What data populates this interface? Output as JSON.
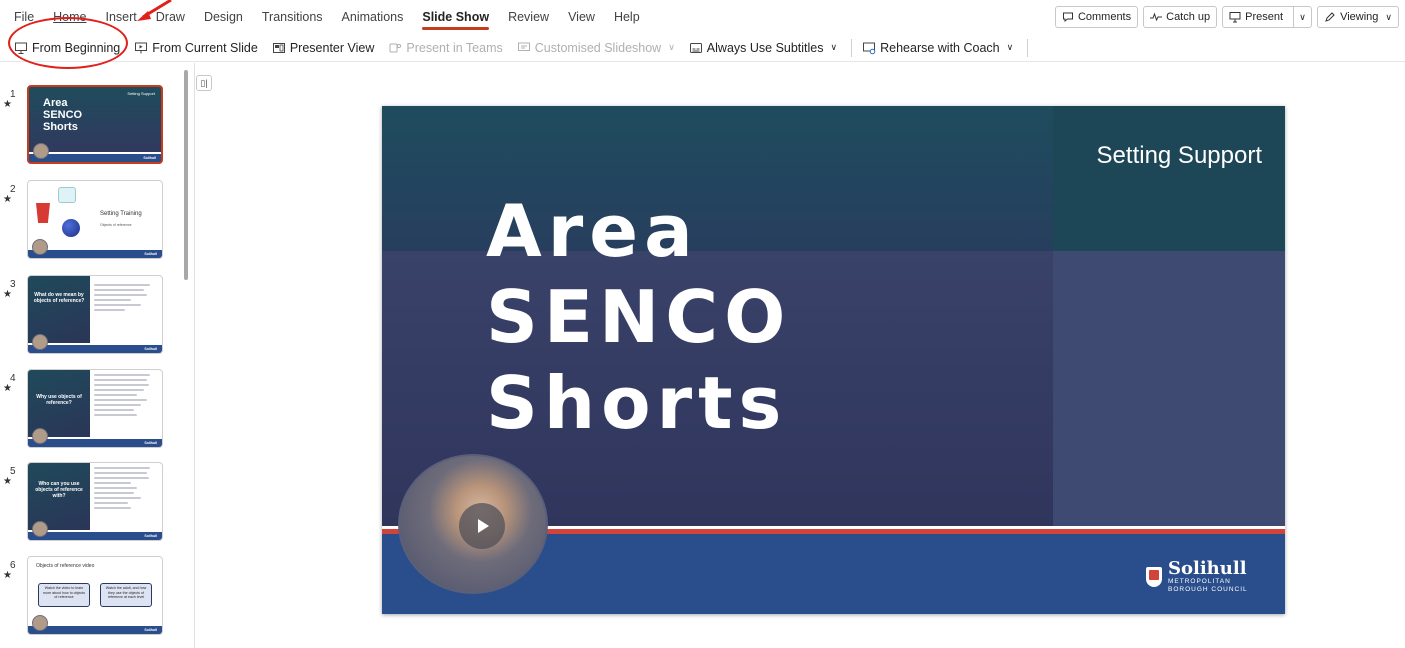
{
  "menu": {
    "tabs": [
      "File",
      "Home",
      "Insert",
      "Draw",
      "Design",
      "Transitions",
      "Animations",
      "Slide Show",
      "Review",
      "View",
      "Help"
    ],
    "active_tab": "Slide Show"
  },
  "top_right": {
    "comments": "Comments",
    "catch_up": "Catch up",
    "present": "Present",
    "viewing": "Viewing"
  },
  "ribbon": {
    "from_beginning": "From Beginning",
    "from_current": "From Current Slide",
    "presenter_view": "Presenter View",
    "present_in_teams": "Present in Teams",
    "customised_slideshow": "Customised Slideshow",
    "always_use_subtitles": "Always Use Subtitles",
    "rehearse_with_coach": "Rehearse with Coach"
  },
  "thumbnails": [
    {
      "num": "1",
      "star": "★",
      "title": "Area SENCO Shorts",
      "tag": "Setting Support"
    },
    {
      "num": "2",
      "star": "★",
      "title": "Setting Training",
      "sub": "Objects of reference"
    },
    {
      "num": "3",
      "star": "★",
      "title": "What do we mean by objects of reference?"
    },
    {
      "num": "4",
      "star": "★",
      "title": "Why use objects of reference?"
    },
    {
      "num": "5",
      "star": "★",
      "title": "Who can you use objects of reference with?"
    },
    {
      "num": "6",
      "star": "★",
      "title": "Objects of reference video",
      "box1": "Watch the video to learn more about how to objects of reference",
      "box2": "Watch the adult, and how they use the objects of reference at each level"
    }
  ],
  "slide": {
    "subtitle": "Setting Support",
    "title_lines": [
      "Area",
      "SENCO",
      "Shorts"
    ],
    "logo_name": "Solihull",
    "logo_sub1": "METROPOLITAN",
    "logo_sub2": "BOROUGH COUNCIL"
  },
  "colors": {
    "accent": "#c43e1c",
    "annotation": "#e0201b",
    "slide_footer": "#2a4d8c",
    "slide_red_stripe": "#d2433c"
  }
}
